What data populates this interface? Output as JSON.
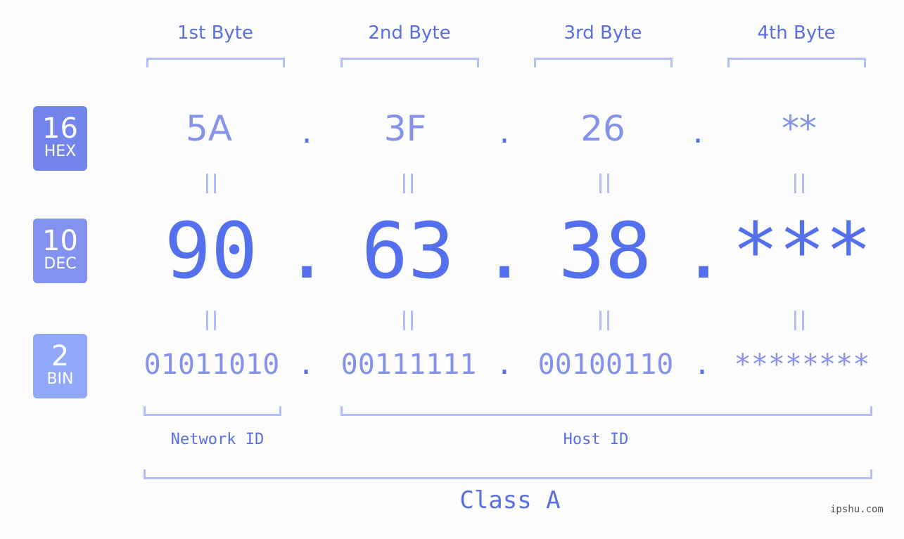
{
  "byte_headers": [
    "1st Byte",
    "2nd Byte",
    "3rd Byte",
    "4th Byte"
  ],
  "badges": {
    "hex": {
      "number": "16",
      "label": "HEX",
      "color": "#7385ea"
    },
    "dec": {
      "number": "10",
      "label": "DEC",
      "color": "#8392ef"
    },
    "bin": {
      "number": "2",
      "label": "BIN",
      "color": "#90a8f8"
    }
  },
  "hex_values": [
    "5A",
    "3F",
    "26",
    "**"
  ],
  "dec_values": [
    "90",
    "63",
    "38",
    "***"
  ],
  "bin_values": [
    "01011010",
    "00111111",
    "00100110",
    "********"
  ],
  "separator": ".",
  "network_id_label": "Network ID",
  "host_id_label": "Host ID",
  "class_label": "Class A",
  "watermark": "ipshu.com",
  "colors": {
    "accent": "#5570ec",
    "light_text": "#8592ea",
    "bracket": "#b3bdf7",
    "background": "#fbfcfb"
  }
}
